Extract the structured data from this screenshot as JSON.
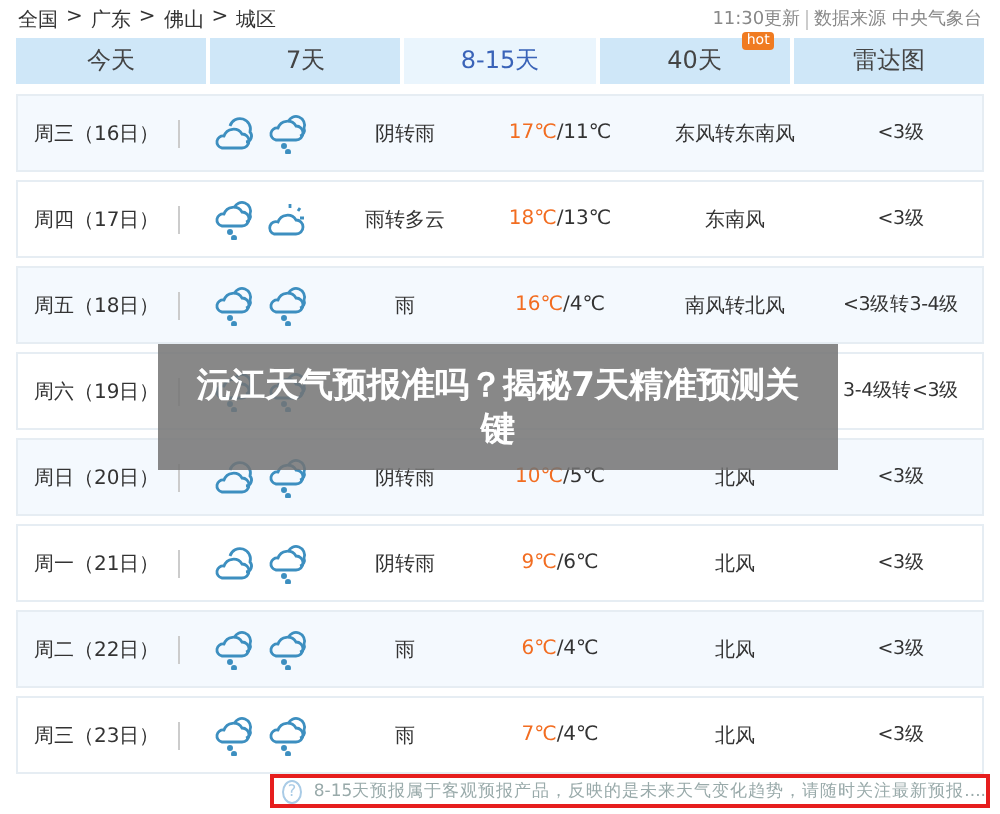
{
  "breadcrumb": [
    {
      "label": "全国"
    },
    {
      "label": "广东"
    },
    {
      "label": "佛山"
    },
    {
      "label": "城区"
    }
  ],
  "separator": ">",
  "update_info": {
    "time": "11:30更新",
    "source": "数据来源 中央气象台"
  },
  "tabs": [
    {
      "label": "今天",
      "selected": false
    },
    {
      "label": "7天",
      "selected": false
    },
    {
      "label": "8-15天",
      "selected": true
    },
    {
      "label": "40天",
      "selected": false,
      "badge": "hot"
    },
    {
      "label": "雷达图",
      "selected": false
    }
  ],
  "days": [
    {
      "day": "周三（16日）",
      "icons": [
        {
          "kind": "cloudy"
        },
        {
          "kind": "rain"
        }
      ],
      "weather": "阴转雨",
      "high": "17℃",
      "low": "/11℃",
      "wind": "东风转东南风",
      "level": "<3级"
    },
    {
      "day": "周四（17日）",
      "icons": [
        {
          "kind": "rain"
        },
        {
          "kind": "partly-cloudy"
        }
      ],
      "weather": "雨转多云",
      "high": "18℃",
      "low": "/13℃",
      "wind": "东南风",
      "level": "<3级"
    },
    {
      "day": "周五（18日）",
      "icons": [
        {
          "kind": "rain"
        },
        {
          "kind": "rain"
        }
      ],
      "weather": "雨",
      "high": "16℃",
      "low": "/4℃",
      "wind": "南风转北风",
      "level": "<3级转3-4级"
    },
    {
      "day": "周六（19日）",
      "icons": [
        {
          "kind": "rain"
        },
        {
          "kind": "rain"
        }
      ],
      "level": "3-4级转<3级"
    },
    {
      "day": "周日（20日）",
      "icons": [
        {
          "kind": "cloudy"
        },
        {
          "kind": "rain"
        }
      ],
      "weather": "阴转雨",
      "high": "10℃",
      "low": "/5℃",
      "wind": "北风",
      "level": "<3级"
    },
    {
      "day": "周一（21日）",
      "icons": [
        {
          "kind": "cloudy"
        },
        {
          "kind": "rain"
        }
      ],
      "weather": "阴转雨",
      "high": "9℃",
      "low": "/6℃",
      "wind": "北风",
      "level": "<3级"
    },
    {
      "day": "周二（22日）",
      "icons": [
        {
          "kind": "rain"
        },
        {
          "kind": "rain"
        }
      ],
      "weather": "雨",
      "high": "6℃",
      "low": "/4℃",
      "wind": "北风",
      "level": "<3级"
    },
    {
      "day": "周三（23日）",
      "icons": [
        {
          "kind": "rain"
        },
        {
          "kind": "rain"
        }
      ],
      "weather": "雨",
      "high": "7℃",
      "low": "/4℃",
      "wind": "北风",
      "level": "<3级"
    }
  ],
  "notice": {
    "icon": "?",
    "text": "8-15天预报属于客观预报产品，反映的是未来天气变化趋势，请随时关注最新预报...."
  },
  "overlay_title": "沅江天气预报准吗？揭秘7天精准预测关键"
}
